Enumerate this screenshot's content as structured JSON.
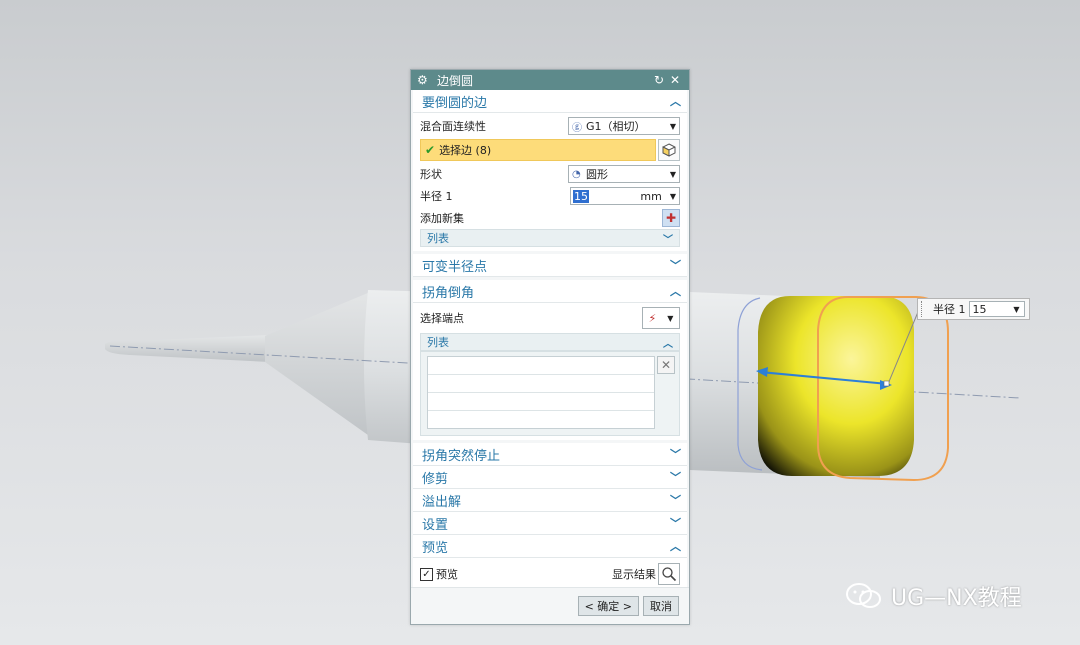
{
  "dialog": {
    "title": "边倒圆",
    "sections": {
      "edges": {
        "header": "要倒圆的边",
        "continuity_label": "混合面连续性",
        "continuity_value": "G1（相切）",
        "select_edge_label": "选择边 (8)",
        "shape_label": "形状",
        "shape_value": "圆形",
        "radius_label": "半径 1",
        "radius_value": "15",
        "radius_unit": "mm",
        "add_set_label": "添加新集",
        "list_label": "列表"
      },
      "variable_radius": {
        "header": "可变半径点"
      },
      "corner_setback": {
        "header": "拐角倒角",
        "select_vertex_label": "选择端点",
        "list_label": "列表"
      },
      "corner_stop": {
        "header": "拐角突然停止"
      },
      "trim": {
        "header": "修剪"
      },
      "overflow": {
        "header": "溢出解"
      },
      "settings": {
        "header": "设置"
      },
      "preview": {
        "header": "预览",
        "preview_checkbox": "预览",
        "show_result_label": "显示结果"
      }
    },
    "ok_label": "< 确定 >",
    "cancel_label": "取消"
  },
  "radius_tag": {
    "label": "半径 1",
    "value": "15"
  },
  "watermark": "UG—NX教程",
  "colors": {
    "title_bar": "#5d8a8b",
    "section_text": "#2a78a8",
    "selection_highlight": "#fddc7a",
    "fillet_yellow": "#f2ea3a",
    "preview_orange": "#f0a050"
  }
}
